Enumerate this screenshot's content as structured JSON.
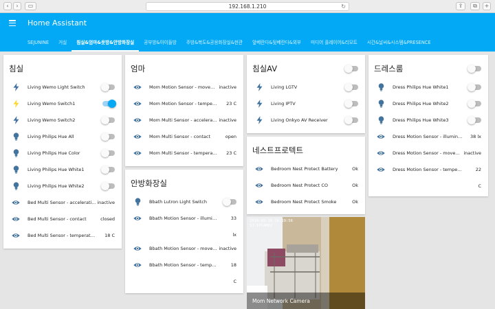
{
  "browser": {
    "url": "192.168.1.210"
  },
  "app": {
    "title": "Home Assistant"
  },
  "tabs": [
    "SEJUNINE",
    "거실",
    "침실&엄마&옷방&안방화장실",
    "공부방&아이들방",
    "주방&복도&공용화장실&현관",
    "앞베란다&뒷베란다&외부",
    "미디어 플레이어&리모트",
    "시간&날씨&시스템&PRESENCE"
  ],
  "active_tab": 2,
  "colors": {
    "primary": "#03a9f4",
    "icon": "#44739e",
    "icon_active": "#fdd835"
  },
  "cards": {
    "bedroom": {
      "title": "침실",
      "rows": [
        {
          "icon": "flash-icon",
          "label": "Living Wemo Light Switch",
          "toggle": "off"
        },
        {
          "icon": "flash-icon",
          "label": "Living Wemo Switch1",
          "toggle": "on"
        },
        {
          "icon": "flash-icon",
          "label": "Living Wemo Switch2",
          "toggle": "off"
        },
        {
          "icon": "bulb-icon",
          "label": "Living Philips Hue All",
          "toggle": "off"
        },
        {
          "icon": "bulb-icon",
          "label": "Living Philips Hue Color",
          "toggle": "off"
        },
        {
          "icon": "bulb-icon",
          "label": "Living Philips Hue White1",
          "toggle": "off"
        },
        {
          "icon": "bulb-icon",
          "label": "Living Philips Hue White2",
          "toggle": "off"
        },
        {
          "icon": "eye-icon",
          "label": "Bed Multi Sensor - acceleration",
          "value": "inactive"
        },
        {
          "icon": "eye-icon",
          "label": "Bed Multi Sensor - contact",
          "value": "closed"
        },
        {
          "icon": "eye-icon",
          "label": "Bed Multi Sensor - temperature",
          "value": "18 C"
        }
      ]
    },
    "mom": {
      "title": "엄마",
      "rows": [
        {
          "icon": "eye-icon",
          "label": "Mom Motion Sensor - moveme...",
          "value": "inactive"
        },
        {
          "icon": "eye-icon",
          "label": "Mom Motion Sensor - temperature",
          "value": "23 C"
        },
        {
          "icon": "eye-icon",
          "label": "Mom Multi Sensor - accelerati...",
          "value": "inactive"
        },
        {
          "icon": "eye-icon",
          "label": "Mom Multi Sensor - contact",
          "value": "open"
        },
        {
          "icon": "eye-icon",
          "label": "Mom Multi Sensor - temperature",
          "value": "23 C"
        }
      ]
    },
    "bath": {
      "title": "안방화장실",
      "rows": [
        {
          "icon": "bulb-icon",
          "label": "Bbath Lutron Light Switch",
          "toggle": "off"
        },
        {
          "icon": "eye-icon",
          "label": "Bbath Motion Sensor - illuminan...",
          "value": "33",
          "value2": "lx"
        },
        {
          "icon": "eye-icon",
          "label": "Bbath Motion Sensor - move...",
          "value": "inactive"
        },
        {
          "icon": "eye-icon",
          "label": "Bbath Motion Sensor - temperat...",
          "value": "18",
          "value2": "C"
        }
      ]
    },
    "bedroom_av": {
      "title": "침실AV",
      "rows": [
        {
          "icon": "flash-icon",
          "label": "Living LGTV",
          "toggle": "off"
        },
        {
          "icon": "flash-icon",
          "label": "Living IPTV",
          "toggle": "off"
        },
        {
          "icon": "flash-icon",
          "label": "Living Onkyo AV Receiver",
          "toggle": "off"
        }
      ]
    },
    "nest": {
      "title": "네스트프로텍트",
      "rows": [
        {
          "icon": "eye-icon",
          "label": "Bedroom Nest Protect Battery",
          "value": "Ok"
        },
        {
          "icon": "eye-icon",
          "label": "Bedroom Nest Protect CO",
          "value": "Ok"
        },
        {
          "icon": "eye-icon",
          "label": "Bedroom Nest Protect Smoke",
          "value": "Ok"
        }
      ]
    },
    "dressroom": {
      "title": "드레스룸",
      "rows": [
        {
          "icon": "bulb-icon",
          "label": "Dress Philips Hue White1",
          "toggle": "off"
        },
        {
          "icon": "bulb-icon",
          "label": "Dress Philips Hue White2",
          "toggle": "off"
        },
        {
          "icon": "bulb-icon",
          "label": "Dress Philips Hue White3",
          "toggle": "off"
        },
        {
          "icon": "eye-icon",
          "label": "Dress Motion Sensor - illuminance",
          "value": "38 lx"
        },
        {
          "icon": "eye-icon",
          "label": "Dress Motion Sensor - move...",
          "value": "inactive"
        },
        {
          "icon": "eye-icon",
          "label": "Dress Motion Sensor - temperatu...",
          "value": "22",
          "value2": "C"
        }
      ]
    },
    "camera": {
      "caption": "Mom Network Camera",
      "timestamp": "2018-02-18 16:19:56",
      "camera_id": "SJ-IPCAM02"
    }
  }
}
